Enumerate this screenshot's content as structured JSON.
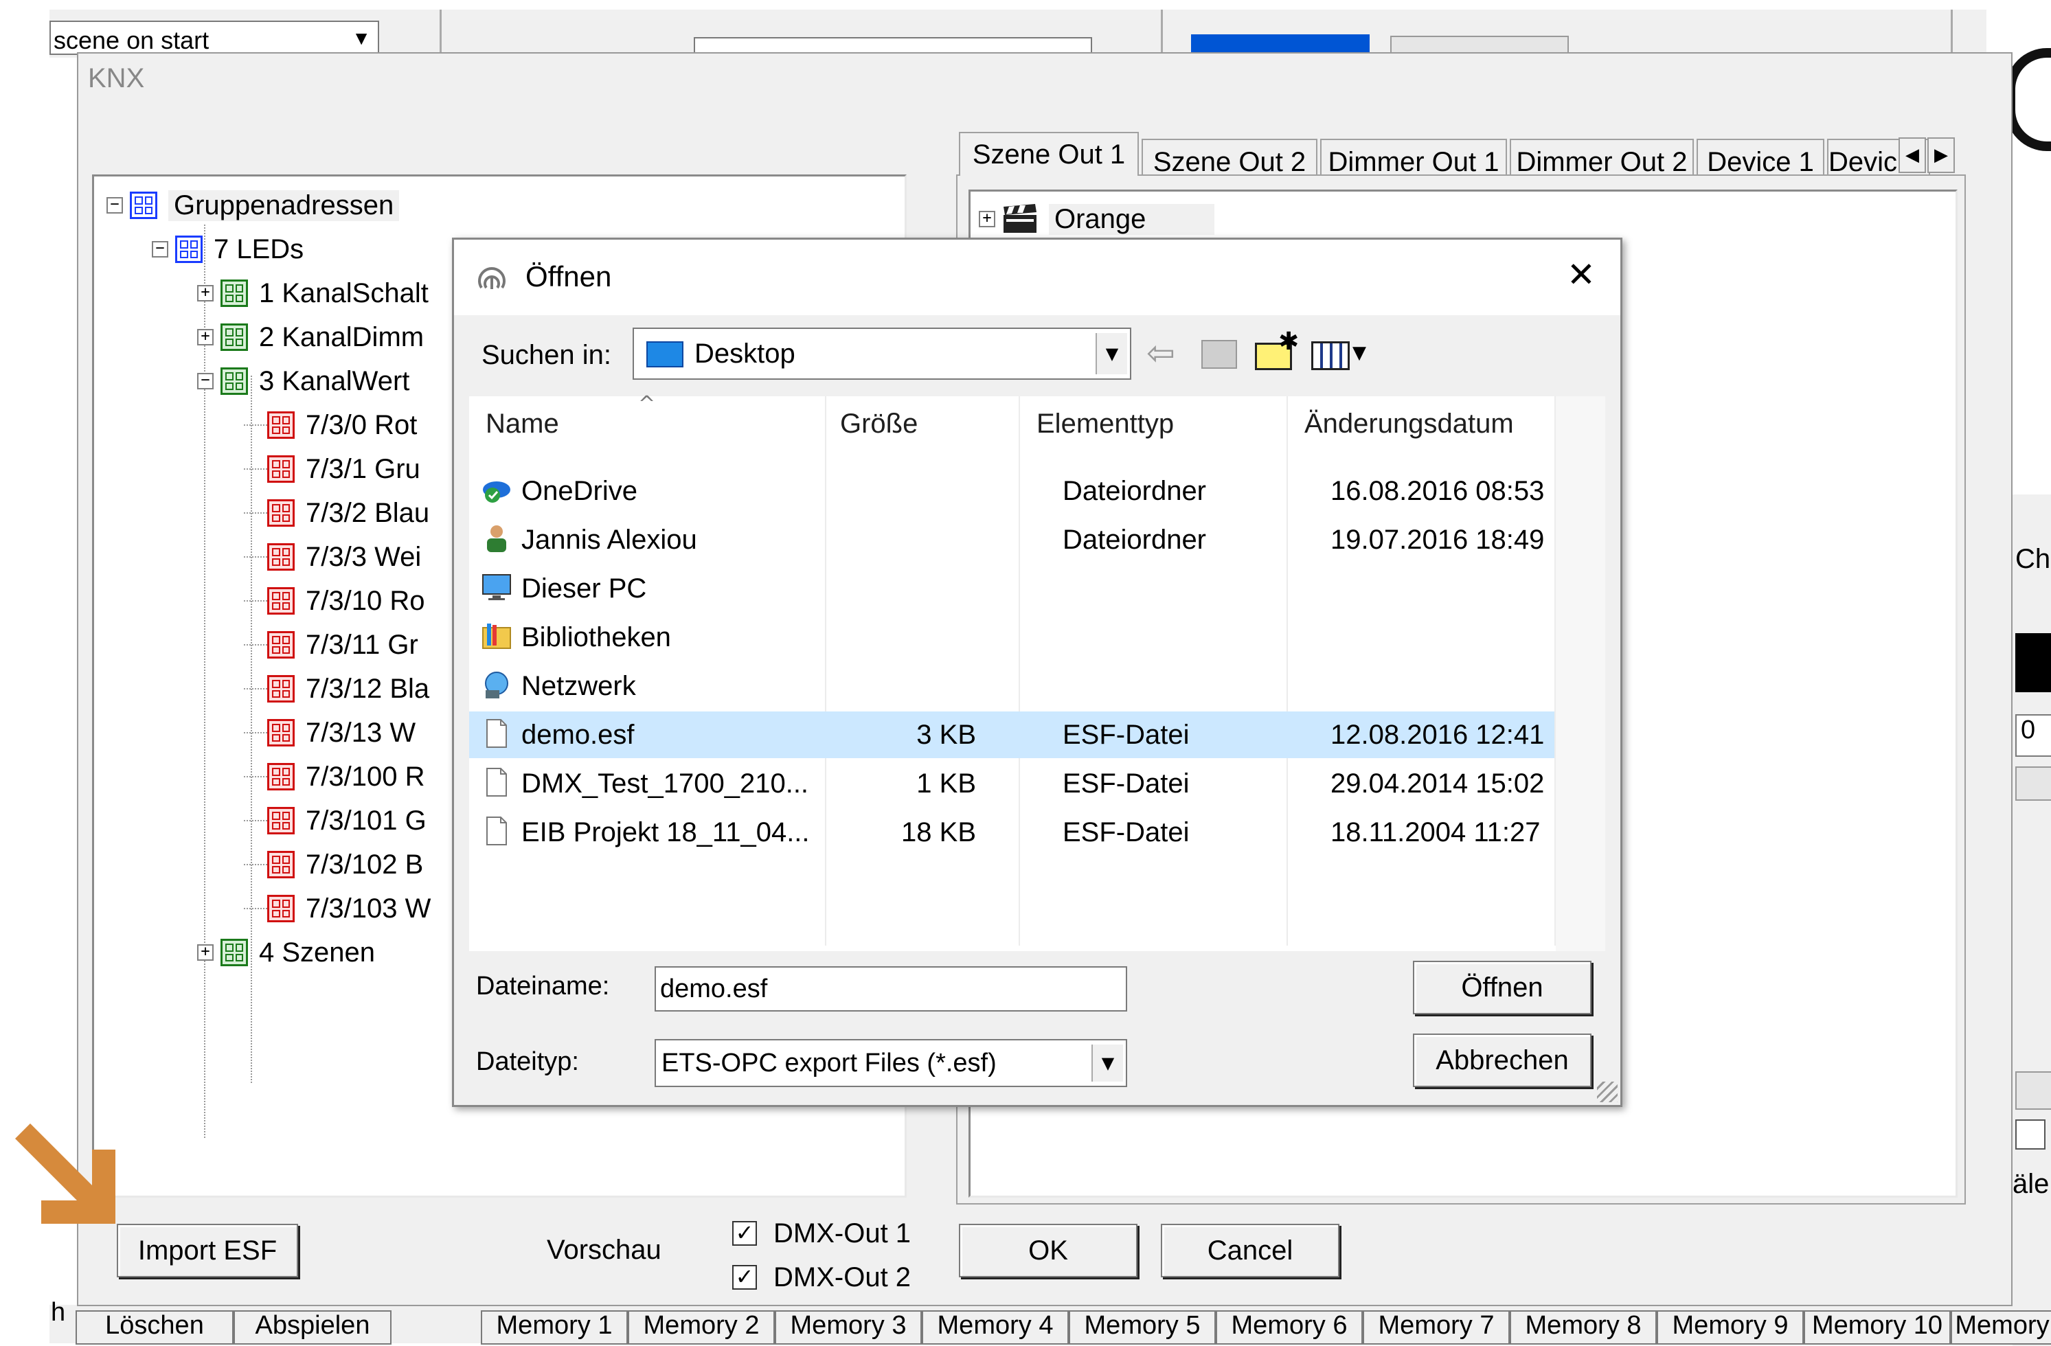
{
  "background_app": {
    "scene_dropdown_text": "scene on start",
    "bottom_buttons": [
      "Löschen",
      "Abspielen"
    ],
    "bottom_left_fragment": "h",
    "memory_buttons": [
      "Memory 1",
      "Memory 2",
      "Memory 3",
      "Memory 4",
      "Memory 5",
      "Memory 6",
      "Memory 7",
      "Memory 8",
      "Memory 9",
      "Memory 10",
      "Memory"
    ],
    "right_label_fragment": "Ch",
    "right_input_fragment": "0",
    "right_bottom_fragment": "äle"
  },
  "knx_window": {
    "title": "KNX",
    "tree": {
      "root": "Gruppenadressen",
      "group": "7 LEDs",
      "items": [
        {
          "label": "1 KanalSchalt",
          "level": 2,
          "icon": "green",
          "expander": "+"
        },
        {
          "label": "2 KanalDimm",
          "level": 2,
          "icon": "green",
          "expander": "+"
        },
        {
          "label": "3 KanalWert",
          "level": 2,
          "icon": "green",
          "expander": "−"
        },
        {
          "label": "7/3/0 Rot",
          "level": 3,
          "icon": "red"
        },
        {
          "label": "7/3/1 Gru",
          "level": 3,
          "icon": "red"
        },
        {
          "label": "7/3/2 Blau",
          "level": 3,
          "icon": "red"
        },
        {
          "label": "7/3/3 Wei",
          "level": 3,
          "icon": "red"
        },
        {
          "label": "7/3/10 Ro",
          "level": 3,
          "icon": "red"
        },
        {
          "label": "7/3/11 Gr",
          "level": 3,
          "icon": "red"
        },
        {
          "label": "7/3/12 Bla",
          "level": 3,
          "icon": "red"
        },
        {
          "label": "7/3/13 W",
          "level": 3,
          "icon": "red"
        },
        {
          "label": "7/3/100 R",
          "level": 3,
          "icon": "red"
        },
        {
          "label": "7/3/101 G",
          "level": 3,
          "icon": "red"
        },
        {
          "label": "7/3/102 B",
          "level": 3,
          "icon": "red"
        },
        {
          "label": "7/3/103 W",
          "level": 3,
          "icon": "red"
        },
        {
          "label": "4 Szenen",
          "level": 2,
          "icon": "green",
          "expander": "+"
        }
      ]
    },
    "tabs": [
      "Szene Out 1",
      "Szene Out 2",
      "Dimmer Out 1",
      "Dimmer Out 2",
      "Device 1",
      "Devic"
    ],
    "active_tab": 0,
    "right_tree_item": "Orange",
    "import_button": "Import ESF",
    "preview_label": "Vorschau",
    "dmx_out_1": {
      "label": "DMX-Out 1",
      "checked": true
    },
    "dmx_out_2": {
      "label": "DMX-Out 2",
      "checked": true
    },
    "ok_button": "OK",
    "cancel_button": "Cancel"
  },
  "open_dialog": {
    "title": "Öffnen",
    "close_symbol": "✕",
    "look_in_label": "Suchen in:",
    "look_in_value": "Desktop",
    "columns": [
      "Name",
      "Größe",
      "Elementtyp",
      "Änderungsdatum"
    ],
    "files": [
      {
        "name": "OneDrive",
        "size": "",
        "type": "Dateiordner",
        "date": "16.08.2016 08:53",
        "icon": "onedrive-icon"
      },
      {
        "name": "Jannis Alexiou",
        "size": "",
        "type": "Dateiordner",
        "date": "19.07.2016 18:49",
        "icon": "user-icon"
      },
      {
        "name": "Dieser PC",
        "size": "",
        "type": "",
        "date": "",
        "icon": "computer-icon"
      },
      {
        "name": "Bibliotheken",
        "size": "",
        "type": "",
        "date": "",
        "icon": "library-icon"
      },
      {
        "name": "Netzwerk",
        "size": "",
        "type": "",
        "date": "",
        "icon": "network-icon"
      },
      {
        "name": "demo.esf",
        "size": "3 KB",
        "type": "ESF-Datei",
        "date": "12.08.2016 12:41",
        "icon": "file-icon",
        "selected": true
      },
      {
        "name": "DMX_Test_1700_210...",
        "size": "1 KB",
        "type": "ESF-Datei",
        "date": "29.04.2014 15:02",
        "icon": "file-icon"
      },
      {
        "name": "EIB Projekt 18_11_04...",
        "size": "18 KB",
        "type": "ESF-Datei",
        "date": "18.11.2004 11:27",
        "icon": "file-icon"
      }
    ],
    "filename_label": "Dateiname:",
    "filename_value": "demo.esf",
    "filetype_label": "Dateityp:",
    "filetype_value": "ETS-OPC export Files (*.esf)",
    "open_button": "Öffnen",
    "cancel_button": "Abbrechen"
  },
  "colors": {
    "selection": "#cce8ff",
    "annotation_arrow": "#d68a3c",
    "window_bg": "#f0f0f0"
  }
}
